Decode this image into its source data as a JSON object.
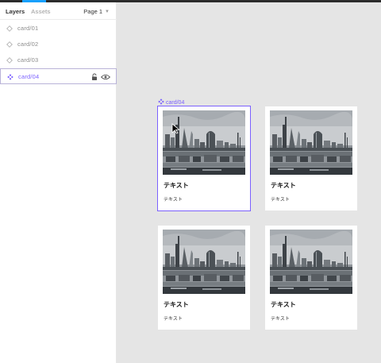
{
  "sidebar": {
    "tabs": {
      "layers": "Layers",
      "assets": "Assets"
    },
    "page_selector": "Page 1",
    "layers": [
      {
        "label": "card/01"
      },
      {
        "label": "card/02"
      },
      {
        "label": "card/03"
      },
      {
        "label": "card/04"
      }
    ]
  },
  "canvas": {
    "frame_label": "card/04",
    "cards": [
      {
        "title": "テキスト",
        "text": "テキスト"
      },
      {
        "title": "テキスト",
        "text": "テキスト"
      },
      {
        "title": "テキスト",
        "text": "テキスト"
      },
      {
        "title": "テキスト",
        "text": "テキスト"
      }
    ]
  },
  "colors": {
    "accent": "#7b61ff",
    "tab_indicator": "#18a0fb",
    "canvas_bg": "#e5e5e5"
  },
  "icons": [
    "component-instance-icon",
    "component-icon",
    "lock-icon",
    "eye-icon",
    "chevron-down-icon",
    "cursor-icon"
  ]
}
